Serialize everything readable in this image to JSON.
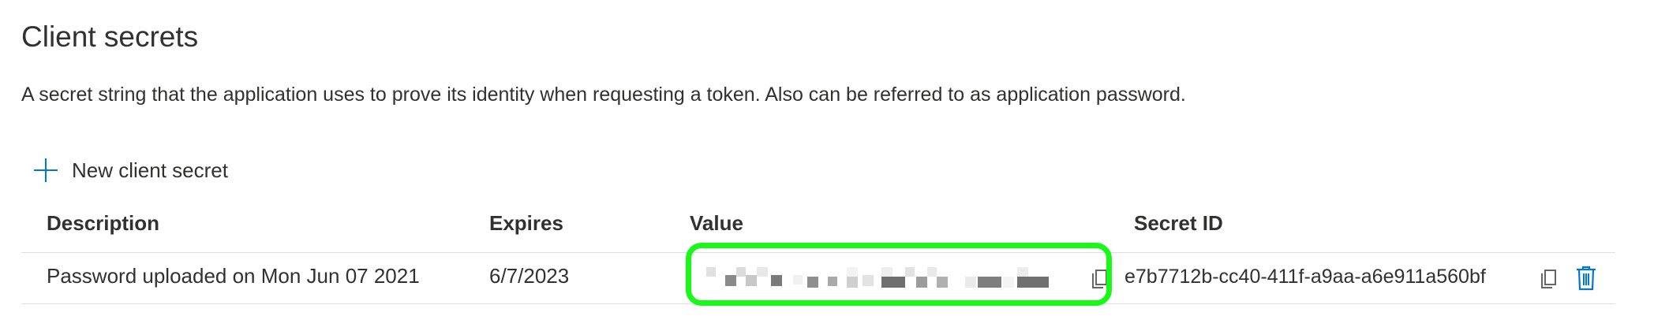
{
  "section": {
    "title": "Client secrets",
    "description": "A secret string that the application uses to prove its identity when requesting a token. Also can be referred to as application password."
  },
  "toolbar": {
    "new_secret_label": "New client secret",
    "new_secret_icon": "plus-icon"
  },
  "table": {
    "columns": [
      "Description",
      "Expires",
      "Value",
      "Secret ID"
    ],
    "rows": [
      {
        "description": "Password uploaded on Mon Jun 07 2021",
        "expires": "6/7/2023",
        "value": "",
        "secret_id": "e7b7712b-cc40-411f-a9aa-a6e911a560bf"
      }
    ]
  },
  "colors": {
    "accent": "#0078d4",
    "highlight": "#19f819",
    "text": "#323130",
    "divider": "#e1dfdd"
  }
}
